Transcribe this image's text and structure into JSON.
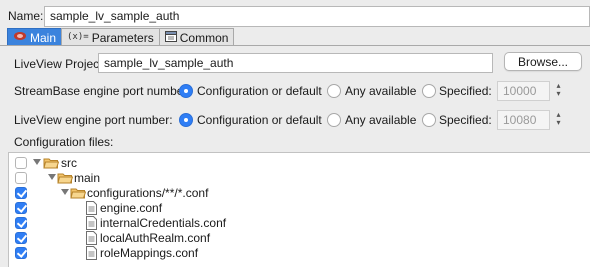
{
  "name": {
    "label": "Name:",
    "value": "sample_lv_sample_auth"
  },
  "tabs": [
    {
      "label": "Main",
      "icon": "main-tab-icon",
      "active": true
    },
    {
      "label": "Parameters",
      "icon": "parameters-tab-icon",
      "active": false
    },
    {
      "label": "Common",
      "icon": "common-tab-icon",
      "active": false
    }
  ],
  "liveview_project": {
    "label": "LiveView Project:",
    "value": "sample_lv_sample_auth",
    "browse_label": "Browse..."
  },
  "streambase_port": {
    "label": "StreamBase engine port number:",
    "options": [
      "Configuration or default",
      "Any available",
      "Specified:"
    ],
    "selected": "Configuration or default",
    "specified_value": "10000"
  },
  "liveview_port": {
    "label": "LiveView engine port number:",
    "options": [
      "Configuration or default",
      "Any available",
      "Specified:"
    ],
    "selected": "Configuration or default",
    "specified_value": "10080"
  },
  "config_files": {
    "label": "Configuration files:",
    "tree": [
      {
        "label": "src",
        "type": "folder",
        "checked": false,
        "depth": 0,
        "expanded": true
      },
      {
        "label": "main",
        "type": "folder",
        "checked": false,
        "depth": 1,
        "expanded": true
      },
      {
        "label": "configurations/**/*.conf",
        "type": "folder",
        "checked": true,
        "depth": 2,
        "expanded": true
      },
      {
        "label": "engine.conf",
        "type": "file",
        "checked": true,
        "depth": 3
      },
      {
        "label": "internalCredentials.conf",
        "type": "file",
        "checked": true,
        "depth": 3
      },
      {
        "label": "localAuthRealm.conf",
        "type": "file",
        "checked": true,
        "depth": 3
      },
      {
        "label": "roleMappings.conf",
        "type": "file",
        "checked": true,
        "depth": 3
      }
    ]
  },
  "colors": {
    "accent": "#2f7ef5",
    "tab_active": "#3b83dd",
    "folder": "#e8a63a"
  }
}
